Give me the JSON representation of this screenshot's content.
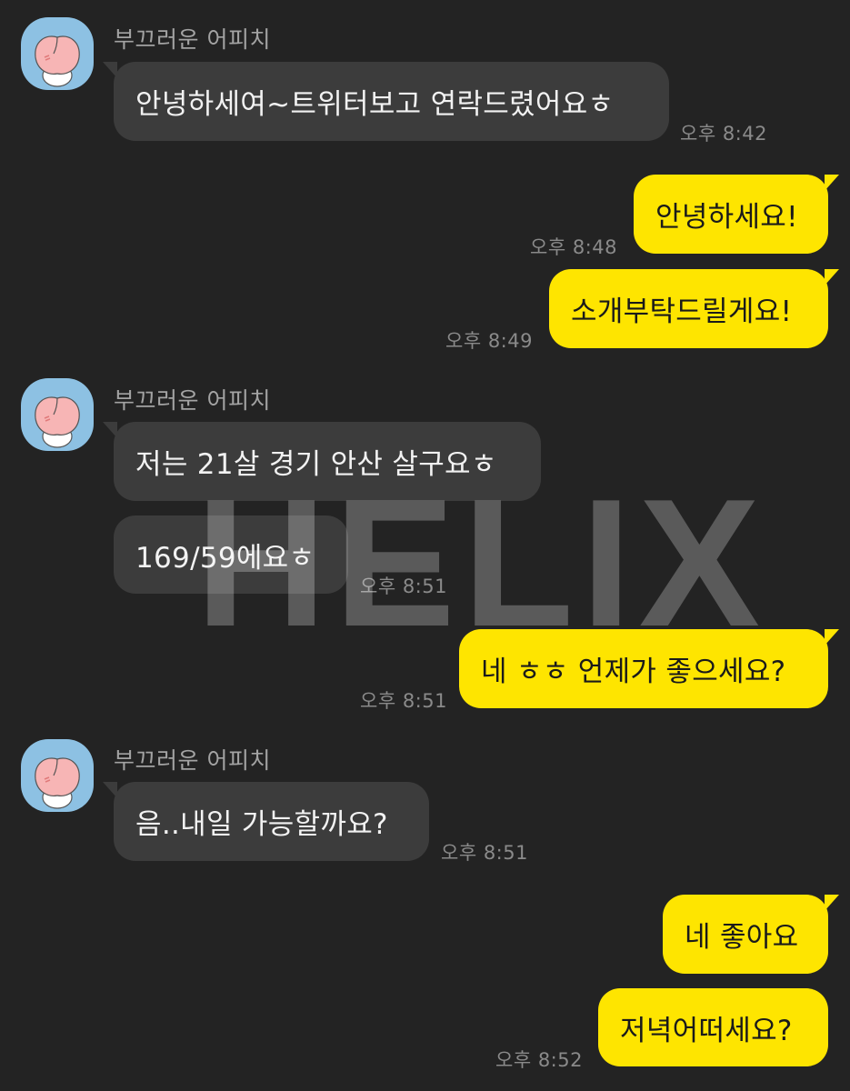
{
  "chat": {
    "sender_name": "부끄러운 어피치",
    "avatar_icon": "apeach-peach-icon",
    "colors": {
      "background": "#232323",
      "incoming_bubble": "#3c3c3c",
      "outgoing_bubble": "#fee500"
    },
    "messages": [
      {
        "from": "them",
        "text": "안녕하세여~트위터보고 연락드렸어요ㅎ",
        "time": "오후 8:42"
      },
      {
        "from": "me",
        "text": "안녕하세요!",
        "time": "오후 8:48"
      },
      {
        "from": "me",
        "text": "소개부탁드릴게요!",
        "time": "오후 8:49"
      },
      {
        "from": "them",
        "text": "저는 21살 경기 안산 살구요ㅎ",
        "time": ""
      },
      {
        "from": "them",
        "text": "169/59에요ㅎ",
        "time": "오후 8:51"
      },
      {
        "from": "me",
        "text": "네 ㅎㅎ 언제가 좋으세요?",
        "time": "오후 8:51"
      },
      {
        "from": "them",
        "text": "음..내일 가능할까요?",
        "time": "오후 8:51"
      },
      {
        "from": "me",
        "text": "네 좋아요",
        "time": ""
      },
      {
        "from": "me",
        "text": "저녁어떠세요?",
        "time": "오후 8:52"
      }
    ]
  },
  "watermark": "HELIX"
}
